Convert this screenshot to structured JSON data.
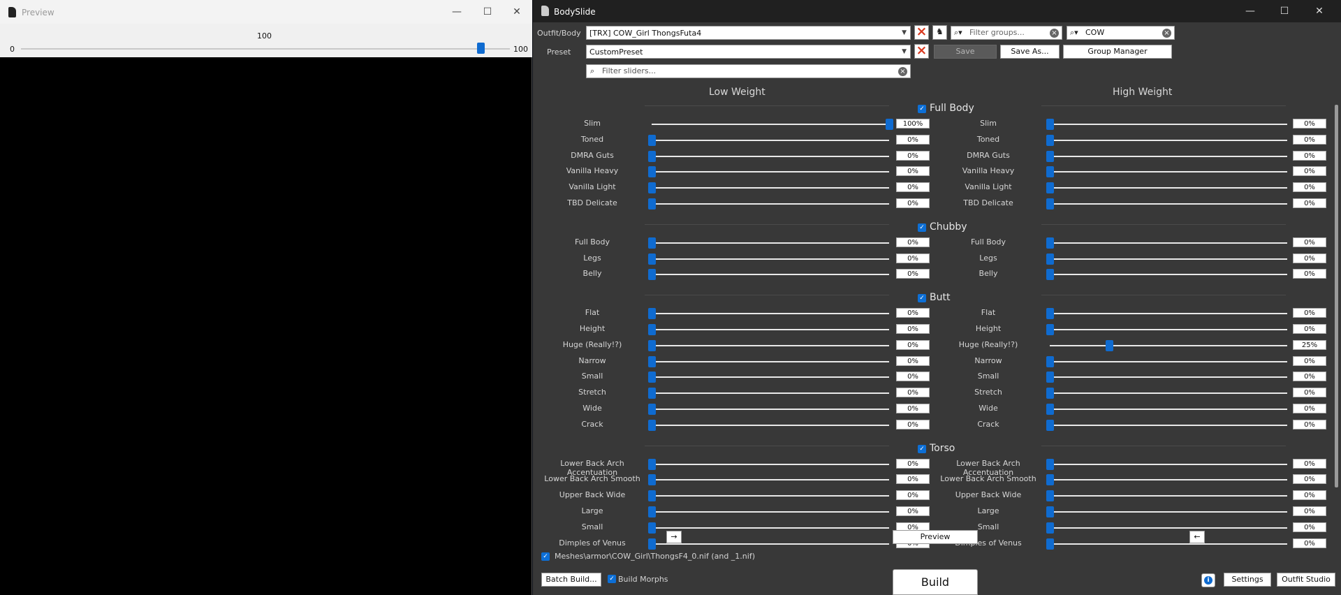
{
  "preview": {
    "title": "Preview",
    "slider": {
      "min_label": "0",
      "max_label": "100",
      "current_label": "100",
      "value_fraction": 0.94
    }
  },
  "window": {
    "title": "BodySlide"
  },
  "top": {
    "outfit_label": "Outfit/Body",
    "outfit_value": "[TRX] COW_Girl ThongsFuta4",
    "preset_label": "Preset",
    "preset_value": "CustomPreset",
    "group_filter_placeholder": "Filter groups...",
    "outfit_filter_value": "COW",
    "slider_filter_placeholder": "Filter sliders...",
    "save_label": "Save",
    "save_as_label": "Save As...",
    "group_manager_label": "Group Manager"
  },
  "columns": {
    "low": "Low Weight",
    "high": "High Weight"
  },
  "categories": [
    {
      "name": "Full Body",
      "sliders": [
        {
          "name": "Slim",
          "low": 100,
          "high": 0
        },
        {
          "name": "Toned",
          "low": 0,
          "high": 0
        },
        {
          "name": "DMRA Guts",
          "low": 0,
          "high": 0
        },
        {
          "name": "Vanilla Heavy",
          "low": 0,
          "high": 0
        },
        {
          "name": "Vanilla Light",
          "low": 0,
          "high": 0
        },
        {
          "name": "TBD Delicate",
          "low": 0,
          "high": 0
        }
      ]
    },
    {
      "name": "Chubby",
      "sliders": [
        {
          "name": "Full Body",
          "low": 0,
          "high": 0
        },
        {
          "name": "Legs",
          "low": 0,
          "high": 0
        },
        {
          "name": "Belly",
          "low": 0,
          "high": 0
        }
      ]
    },
    {
      "name": "Butt",
      "sliders": [
        {
          "name": "Flat",
          "low": 0,
          "high": 0
        },
        {
          "name": "Height",
          "low": 0,
          "high": 0
        },
        {
          "name": "Huge (Really!?)",
          "low": 0,
          "high": 25
        },
        {
          "name": "Narrow",
          "low": 0,
          "high": 0
        },
        {
          "name": "Small",
          "low": 0,
          "high": 0
        },
        {
          "name": "Stretch",
          "low": 0,
          "high": 0
        },
        {
          "name": "Wide",
          "low": 0,
          "high": 0
        },
        {
          "name": "Crack",
          "low": 0,
          "high": 0
        }
      ]
    },
    {
      "name": "Torso",
      "sliders": [
        {
          "name": "Lower Back Arch Accentuation",
          "low": 0,
          "high": 0
        },
        {
          "name": "Lower Back Arch Smooth",
          "low": 0,
          "high": 0
        },
        {
          "name": "Upper Back Wide",
          "low": 0,
          "high": 0
        },
        {
          "name": "Large",
          "low": 0,
          "high": 0
        },
        {
          "name": "Small",
          "low": 0,
          "high": 0
        },
        {
          "name": "Dimples of Venus",
          "low": 0,
          "high": 0
        }
      ]
    }
  ],
  "bottom": {
    "copy_right_label": "→",
    "copy_left_label": "←",
    "preview_label": "Preview",
    "output_path": "Meshes\\armor\\COW_Girl\\ThongsF4_0.nif (and _1.nif)",
    "batch_build_label": "Batch Build...",
    "build_morphs_label": "Build Morphs",
    "build_label": "Build",
    "settings_label": "Settings",
    "outfit_studio_label": "Outfit Studio"
  },
  "colors": {
    "accent": "#0f6bd0",
    "panel": "#383838",
    "close_x": "#d9381e"
  },
  "icons": [
    "minimize-icon",
    "maximize-icon",
    "close-icon",
    "search-icon",
    "clear-icon",
    "checkbox-checked-icon",
    "info-icon",
    "app-icon"
  ]
}
